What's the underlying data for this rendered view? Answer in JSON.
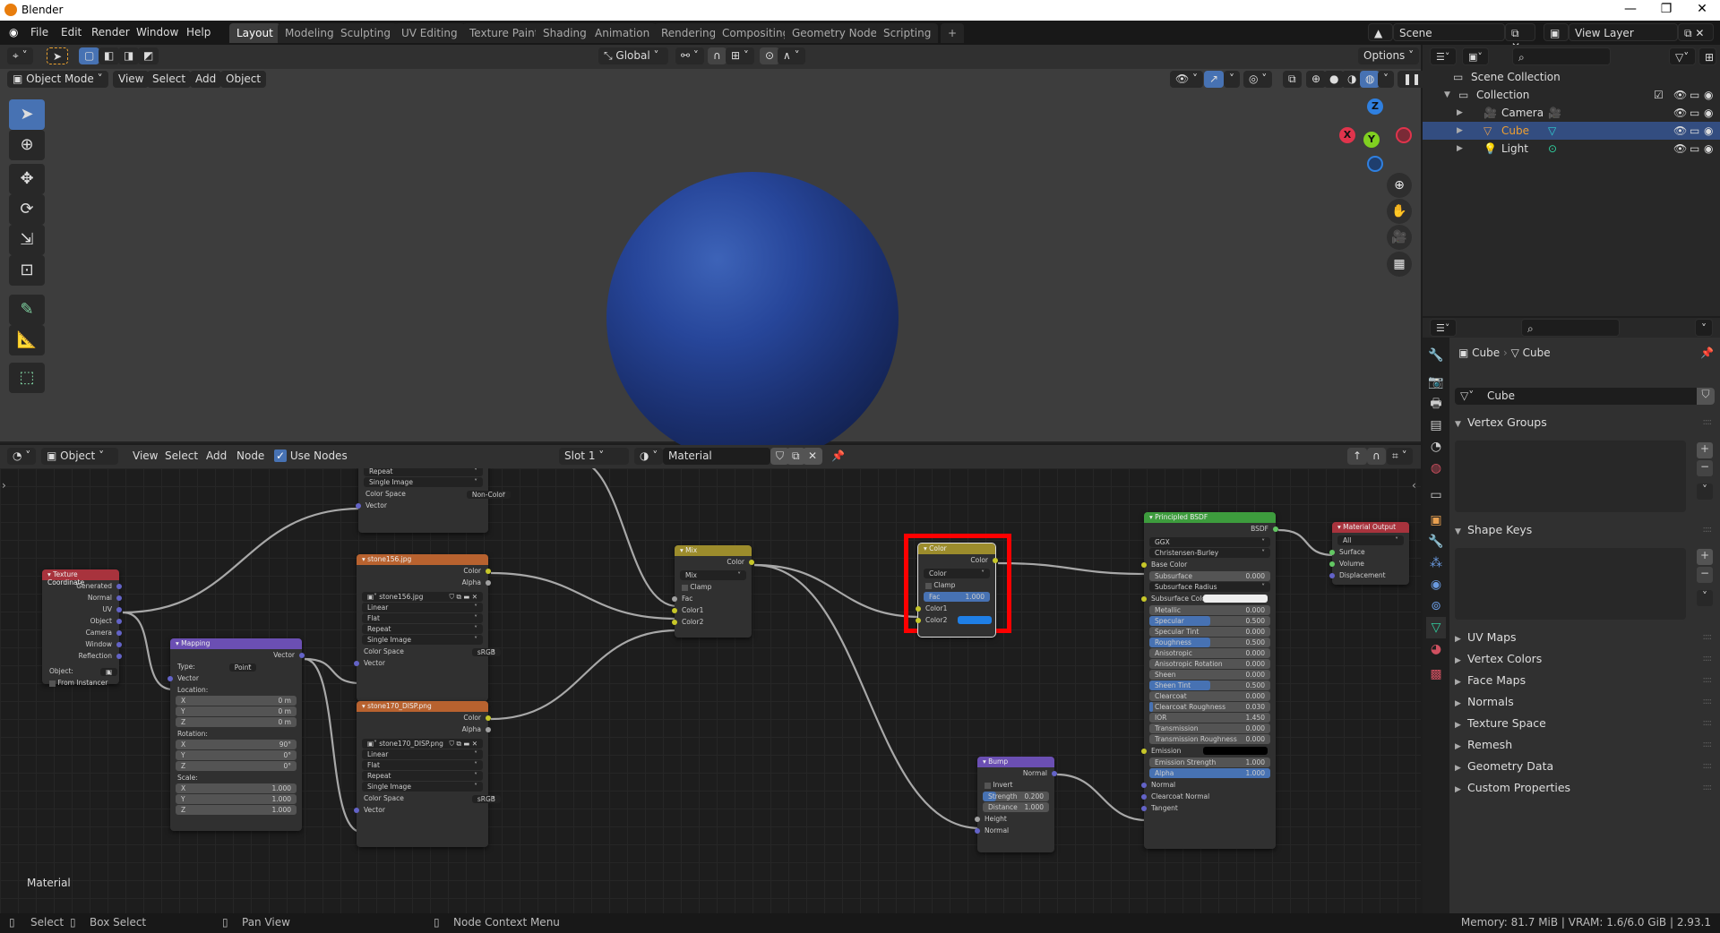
{
  "window": {
    "title": "Blender",
    "minimize": "—",
    "maximize": "❐",
    "close": "✕"
  },
  "menu": [
    "File",
    "Edit",
    "Render",
    "Window",
    "Help"
  ],
  "workspaces": [
    {
      "label": "Layout",
      "active": true
    },
    {
      "label": "Modeling"
    },
    {
      "label": "Sculpting"
    },
    {
      "label": "UV Editing"
    },
    {
      "label": "Texture Paint"
    },
    {
      "label": "Shading"
    },
    {
      "label": "Animation"
    },
    {
      "label": "Rendering"
    },
    {
      "label": "Compositing"
    },
    {
      "label": "Geometry Nodes"
    },
    {
      "label": "Scripting"
    },
    {
      "label": "+"
    }
  ],
  "scene": {
    "name": "Scene",
    "view_layer": "View Layer"
  },
  "viewport": {
    "mode": "Object Mode",
    "menus": [
      "View",
      "Select",
      "Add",
      "Object"
    ],
    "transform_orientation": "Global",
    "options_label": "Options",
    "gizmo": {
      "x": "X",
      "y": "Y",
      "z": "Z"
    }
  },
  "outliner": {
    "items": [
      {
        "label": "Scene Collection",
        "level": 0
      },
      {
        "label": "Collection",
        "level": 1
      },
      {
        "label": "Camera",
        "level": 2
      },
      {
        "label": "Cube",
        "level": 2,
        "selected": true
      },
      {
        "label": "Light",
        "level": 2
      }
    ]
  },
  "properties": {
    "breadcrumb": [
      "Cube",
      "Cube"
    ],
    "datablock": "Cube",
    "panels_open": [
      "Vertex Groups",
      "Shape Keys"
    ],
    "panels_closed": [
      "UV Maps",
      "Vertex Colors",
      "Face Maps",
      "Normals",
      "Texture Space",
      "Remesh",
      "Geometry Data",
      "Custom Properties"
    ]
  },
  "node_editor": {
    "object_label": "Object",
    "menus": [
      "View",
      "Select",
      "Add",
      "Node"
    ],
    "use_nodes_label": "Use Nodes",
    "use_nodes": true,
    "slot": "Slot 1",
    "material": "Material",
    "tree_label": "Material"
  },
  "nodes": {
    "partial_top": {
      "rows": [
        "Repeat",
        "Single Image"
      ],
      "color_space_label": "Color Space",
      "color_space": "Non-Color",
      "vector": "Vector"
    },
    "tex_coord": {
      "title": "Texture Coordinate",
      "outputs": [
        "Generated",
        "Normal",
        "UV",
        "Object",
        "Camera",
        "Window",
        "Reflection"
      ],
      "object_label": "Object:",
      "from_instancer": "From Instancer"
    },
    "mapping": {
      "title": "Mapping",
      "output": "Vector",
      "type_label": "Type:",
      "type": "Point",
      "vector": "Vector",
      "location_label": "Location:",
      "location": [
        {
          "axis": "X",
          "value": "0 m"
        },
        {
          "axis": "Y",
          "value": "0 m"
        },
        {
          "axis": "Z",
          "value": "0 m"
        }
      ],
      "rotation_label": "Rotation:",
      "rotation": [
        {
          "axis": "X",
          "value": "90°"
        },
        {
          "axis": "Y",
          "value": "0°"
        },
        {
          "axis": "Z",
          "value": "0°"
        }
      ],
      "scale_label": "Scale:",
      "scale": [
        {
          "axis": "X",
          "value": "1.000"
        },
        {
          "axis": "Y",
          "value": "1.000"
        },
        {
          "axis": "Z",
          "value": "1.000"
        }
      ]
    },
    "img1": {
      "title": "stone156.jpg",
      "color": "Color",
      "alpha": "Alpha",
      "image": "stone156.jpg",
      "interp": "Linear",
      "proj": "Flat",
      "ext": "Repeat",
      "source": "Single Image",
      "color_space_label": "Color Space",
      "color_space": "sRGB",
      "vector": "Vector"
    },
    "img2": {
      "title": "stone170_DISP.png",
      "color": "Color",
      "alpha": "Alpha",
      "image": "stone170_DISP.png",
      "interp": "Linear",
      "proj": "Flat",
      "ext": "Repeat",
      "source": "Single Image",
      "color_space_label": "Color Space",
      "color_space": "sRGB",
      "vector": "Vector"
    },
    "mix": {
      "title": "Mix",
      "output": "Color",
      "blend": "Mix",
      "clamp": "Clamp",
      "fac": "Fac",
      "color1": "Color1",
      "color2": "Color2"
    },
    "color_mix": {
      "title": "Color",
      "output": "Color",
      "blend": "Color",
      "clamp": "Clamp",
      "fac_label": "Fac",
      "fac": "1.000",
      "fac_fraction": 1.0,
      "color1": "Color1",
      "color2": "Color2",
      "color2_value": "#1f7fe6",
      "highlighted": true
    },
    "bump": {
      "title": "Bump",
      "output": "Normal",
      "invert": "Invert",
      "strength_label": "Strength",
      "strength": "0.200",
      "strength_fraction": 0.2,
      "distance_label": "Distance",
      "distance": "1.000",
      "height": "Height",
      "normal": "Normal"
    },
    "bsdf": {
      "title": "Principled BSDF",
      "output": "BSDF",
      "distribution": "GGX",
      "sss_method": "Christensen-Burley",
      "base_color": "Base Color",
      "params": [
        {
          "label": "Subsurface",
          "value": "0.000",
          "fill": 0
        },
        {
          "label": "Subsurface Radius",
          "dropdown": true
        },
        {
          "label": "Subsurface Colo",
          "swatch": "#eeeeee"
        },
        {
          "label": "Metallic",
          "value": "0.000",
          "fill": 0
        },
        {
          "label": "Specular",
          "value": "0.500",
          "fill": 0.5
        },
        {
          "label": "Specular Tint",
          "value": "0.000",
          "fill": 0
        },
        {
          "label": "Roughness",
          "value": "0.500",
          "fill": 0.5
        },
        {
          "label": "Anisotropic",
          "value": "0.000",
          "fill": 0
        },
        {
          "label": "Anisotropic Rotation",
          "value": "0.000",
          "fill": 0
        },
        {
          "label": "Sheen",
          "value": "0.000",
          "fill": 0
        },
        {
          "label": "Sheen Tint",
          "value": "0.500",
          "fill": 0.5
        },
        {
          "label": "Clearcoat",
          "value": "0.000",
          "fill": 0
        },
        {
          "label": "Clearcoat Roughness",
          "value": "0.030",
          "fill": 0.03
        },
        {
          "label": "IOR",
          "value": "1.450",
          "fill": 0
        },
        {
          "label": "Transmission",
          "value": "0.000",
          "fill": 0
        },
        {
          "label": "Transmission Roughness",
          "value": "0.000",
          "fill": 0
        },
        {
          "label": "Emission",
          "swatch": "#000000"
        },
        {
          "label": "Emission Strength",
          "value": "1.000",
          "fill": 0
        },
        {
          "label": "Alpha",
          "value": "1.000",
          "fill": 1
        }
      ],
      "vector_inputs": [
        "Normal",
        "Clearcoat Normal",
        "Tangent"
      ]
    },
    "output": {
      "title": "Material Output",
      "target": "All",
      "inputs": [
        "Surface",
        "Volume",
        "Displacement"
      ]
    }
  },
  "statusbar": {
    "hints": [
      {
        "label": "Select"
      },
      {
        "label": "Box Select"
      },
      {
        "label": "Pan View"
      },
      {
        "label": "Node Context Menu"
      }
    ],
    "info": "Memory: 81.7 MiB | VRAM: 1.6/6.0 GiB | 2.93.1"
  },
  "colors": {
    "accent": "#4772b3",
    "highlight_box": "#ff0000",
    "tex_coord_header": "#a8333d",
    "mapping_header": "#6b4fb3",
    "image_header": "#b8622f",
    "mix_header": "#9c8c2c",
    "bump_header": "#6b4fb3",
    "bsdf_header": "#3d9c3d",
    "output_header": "#a8333d"
  }
}
